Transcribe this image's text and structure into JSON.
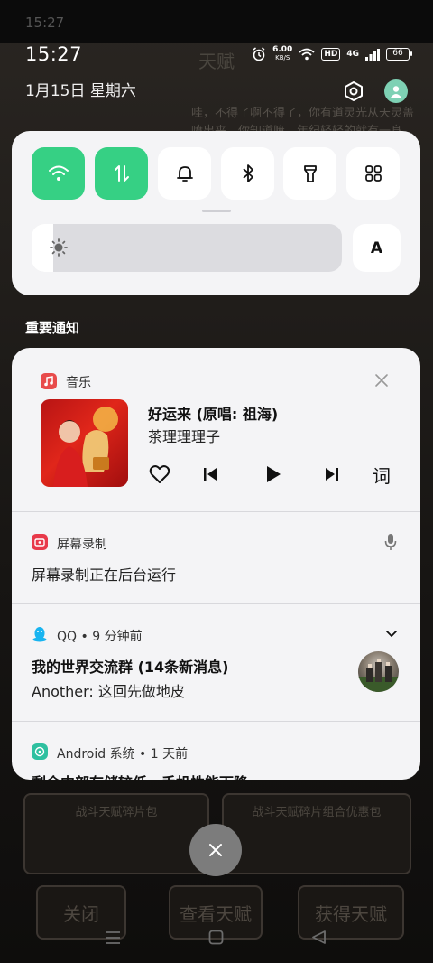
{
  "background_app": {
    "status_time": "15:27",
    "title": "天赋",
    "story_text": "哇，不得了啊不得了，你有道灵光从天灵盖喷出来，你知道嘛，年纪轻轻的就有一身...",
    "cards": [
      "战斗天赋碎片包",
      "战斗天赋碎片组合优惠包"
    ],
    "buttons": {
      "close": "关闭",
      "view": "查看天赋",
      "get": "获得天赋"
    }
  },
  "status_bar": {
    "time": "15:27",
    "net_speed_value": "6.00",
    "net_speed_unit": "KB/S",
    "hd_label": "HD",
    "signal_label": "4G",
    "battery_level": "66"
  },
  "date_row": {
    "date": "1月15日 星期六",
    "settings_icon": "settings-hex-icon",
    "profile_icon": "profile-icon"
  },
  "control_center": {
    "toggles": [
      {
        "name": "wifi",
        "icon": "wifi-icon",
        "on": true
      },
      {
        "name": "mobile-data",
        "icon": "data-arrows-icon",
        "on": true
      },
      {
        "name": "sound",
        "icon": "bell-icon",
        "on": false
      },
      {
        "name": "bluetooth",
        "icon": "bluetooth-icon",
        "on": false
      },
      {
        "name": "flashlight",
        "icon": "flashlight-icon",
        "on": false
      },
      {
        "name": "more",
        "icon": "grid-icon",
        "on": false
      }
    ],
    "brightness_level": 0.07,
    "auto_brightness_label": "A",
    "colors": {
      "toggle_on": "#36d084",
      "panel": "#f4f4f6"
    }
  },
  "important_label": "重要通知",
  "notifications": {
    "music": {
      "app_name": "音乐",
      "song_title": "好运来 (原唱: 祖海)",
      "artist": "茶理理理子",
      "lyrics_label": "词",
      "accent": "#e84b4b"
    },
    "screen_record": {
      "app_name": "屏幕录制",
      "message": "屏幕录制正在后台运行",
      "accent": "#e8394a"
    },
    "qq": {
      "app_name": "QQ",
      "time": "9 分钟前",
      "group_title": "我的世界交流群 (14条新消息)",
      "message": "Another: 这回先做地皮",
      "accent": "#18b4f0"
    },
    "android": {
      "app_name": "Android 系统",
      "time": "1 天前",
      "message": "剩余内部存储较低，手机性能下降",
      "accent": "#2ec0a0"
    }
  }
}
